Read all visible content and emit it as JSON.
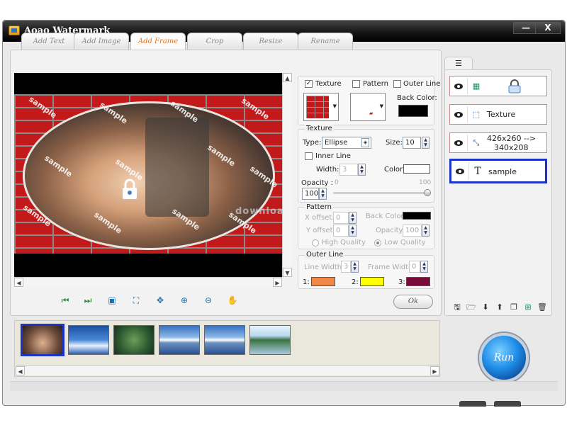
{
  "window": {
    "title": "Aoao Watermark",
    "minimize": "—",
    "close": "X"
  },
  "tabs": [
    {
      "label": "Add Text",
      "active": false
    },
    {
      "label": "Add Image",
      "active": false
    },
    {
      "label": "Add Frame",
      "active": true
    },
    {
      "label": "Crop",
      "active": false
    },
    {
      "label": "Resize",
      "active": false
    },
    {
      "label": "Rename",
      "active": false
    }
  ],
  "preview": {
    "watermark_text": "sample",
    "overlay_text": "download"
  },
  "frame": {
    "texture_check": "Texture",
    "pattern_check": "Pattern",
    "outer_line_check": "Outer Line",
    "back_color_label": "Back Color:",
    "texture_section": "Texture",
    "type_label": "Type:",
    "type_value": "Ellipse",
    "size_label": "Size:",
    "size_value": "10",
    "inner_line_check": "Inner Line",
    "width_label": "Width:",
    "width_value": "3",
    "color_label": "Color:",
    "opacity_label": "Opacity :",
    "opacity_min": "0",
    "opacity_max": "100",
    "opacity_value": "100",
    "opacity_level": 1.0,
    "pattern_section": "Pattern",
    "x_offset_label": "X offset:",
    "x_offset_value": "0",
    "y_offset_label": "Y offset:",
    "y_offset_value": "0",
    "pattern_back_color_label": "Back Color:",
    "pattern_opacity_label": "Opacity:",
    "pattern_opacity_value": "100",
    "high_quality": "High Quality",
    "low_quality": "Low Quality",
    "outer_line_section": "Outer Line",
    "line_width_label": "Line Width:",
    "line_width_value": "3",
    "frame_width_label": "Frame Width:",
    "frame_width_value": "0",
    "color1_label": "1:",
    "color2_label": "2:",
    "color3_label": "3:",
    "colors": {
      "back": "#000000",
      "inner": "#ffffff",
      "c1": "#f0884a",
      "c2": "#ffff00",
      "c3": "#7a0a3a",
      "pattern_back": "#000000"
    }
  },
  "ok_label": "Ok",
  "layers": [
    {
      "icon": "image-layer-icon",
      "text": "",
      "selected": false
    },
    {
      "icon": "frame-layer-icon",
      "text": "Texture",
      "selected": false
    },
    {
      "icon": "resize-layer-icon",
      "text": "426x260 -->",
      "text2": "340x208",
      "selected": false
    },
    {
      "icon": "text-layer-icon",
      "text": "sample",
      "selected": true
    }
  ],
  "run_label": "Run"
}
